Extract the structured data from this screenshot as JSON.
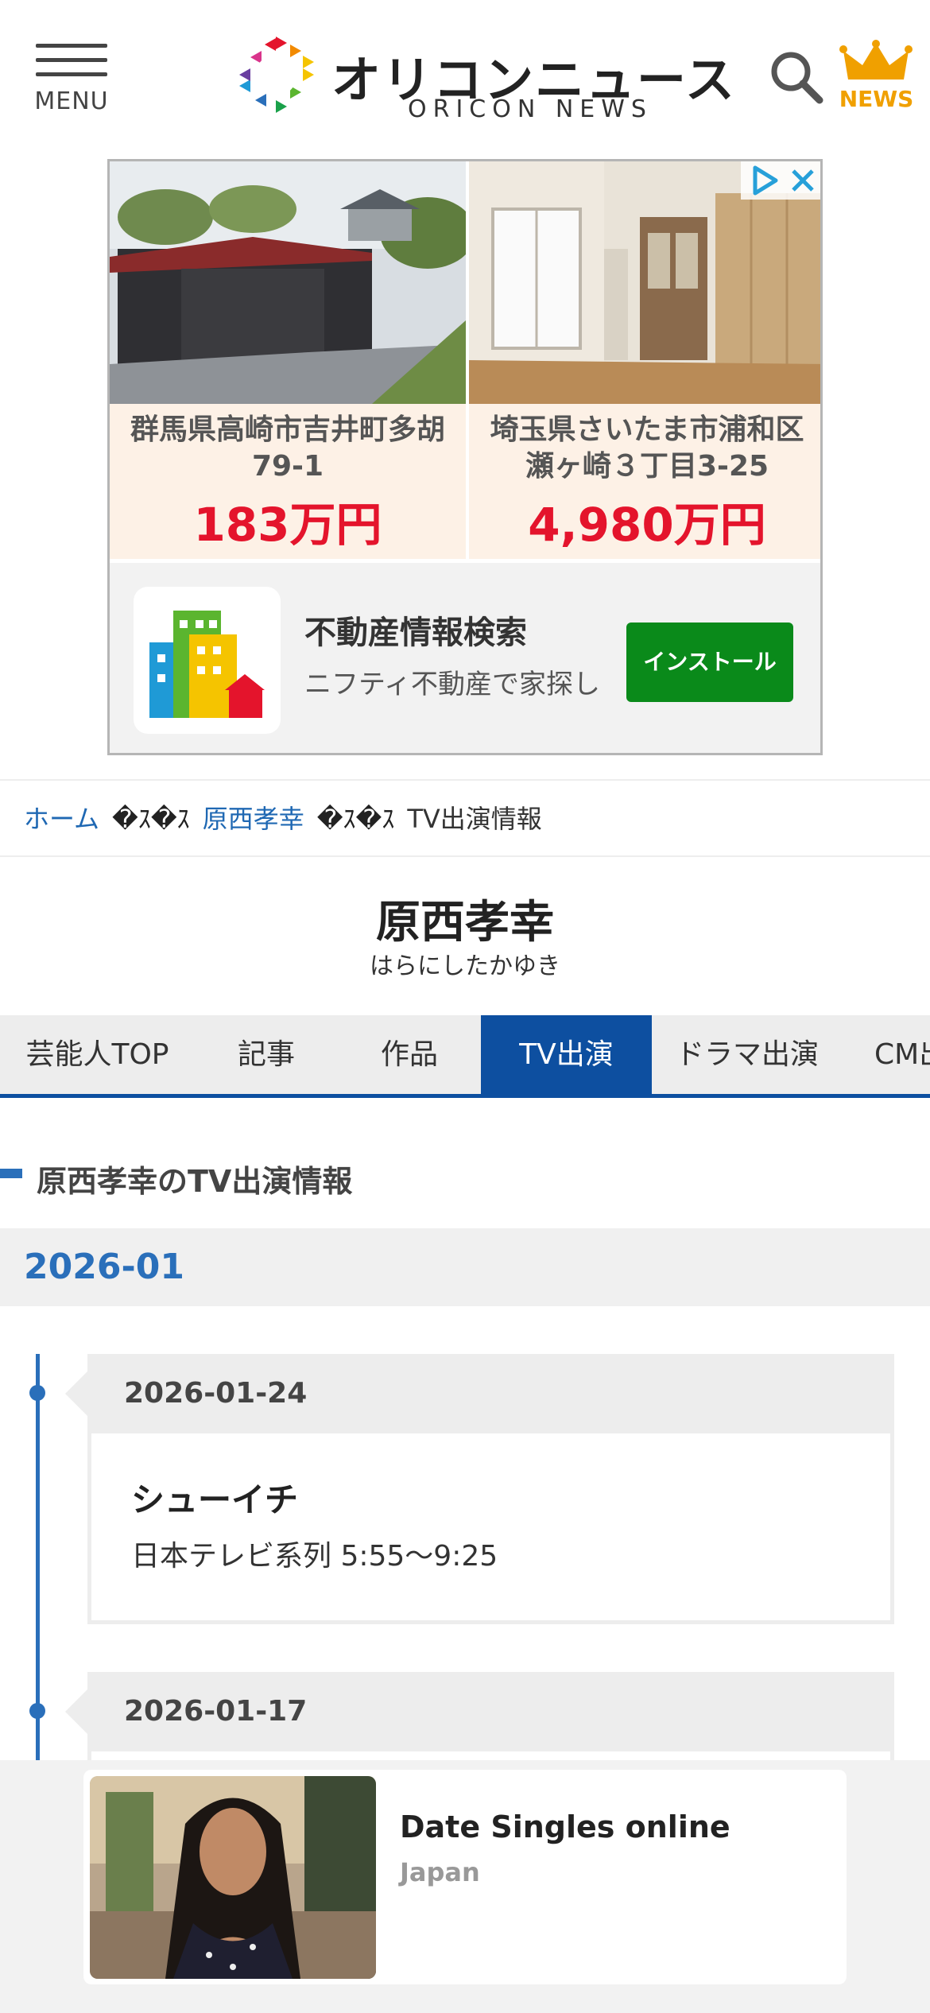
{
  "header": {
    "menu_label": "MENU",
    "logo_jp": "オリコンニュース",
    "logo_en": "ORICON NEWS",
    "news_label": "NEWS"
  },
  "ad_top": {
    "cards": [
      {
        "address": "群馬県高崎市吉井町多胡\n79-1",
        "price": "183万円"
      },
      {
        "address": "埼玉県さいたま市浦和区\n瀬ヶ崎３丁目3-25",
        "price": "4,980万円"
      }
    ],
    "app_title": "不動産情報検索",
    "app_desc": "ニフティ不動産で家探し",
    "install_label": "インストール"
  },
  "breadcrumb": {
    "home": "ホーム",
    "sep": "�ｽ�ｽ",
    "person": "原西孝幸",
    "current": "TV出演情報"
  },
  "person": {
    "name": "原西孝幸",
    "kana": "はらにしたかゆき"
  },
  "tabs": [
    {
      "label": "芸能人TOP"
    },
    {
      "label": "記事"
    },
    {
      "label": "作品"
    },
    {
      "label": "TV出演"
    },
    {
      "label": "ドラマ出演"
    },
    {
      "label": "CM出演"
    }
  ],
  "section": {
    "title": "原西孝幸のTV出演情報",
    "month": "2026-01"
  },
  "entries": [
    {
      "date": "2026-01-24",
      "title": "シューイチ",
      "meta": "日本テレビ系列 5:55〜9:25"
    },
    {
      "date": "2026-01-17"
    }
  ],
  "bottom_ad": {
    "title": "Date Singles online",
    "subtitle": "Japan"
  },
  "colors": {
    "accent": "#0d4fa0",
    "link": "#1f68b3",
    "price": "#e4142c",
    "install": "#0a8a1a",
    "news": "#f0a000"
  }
}
